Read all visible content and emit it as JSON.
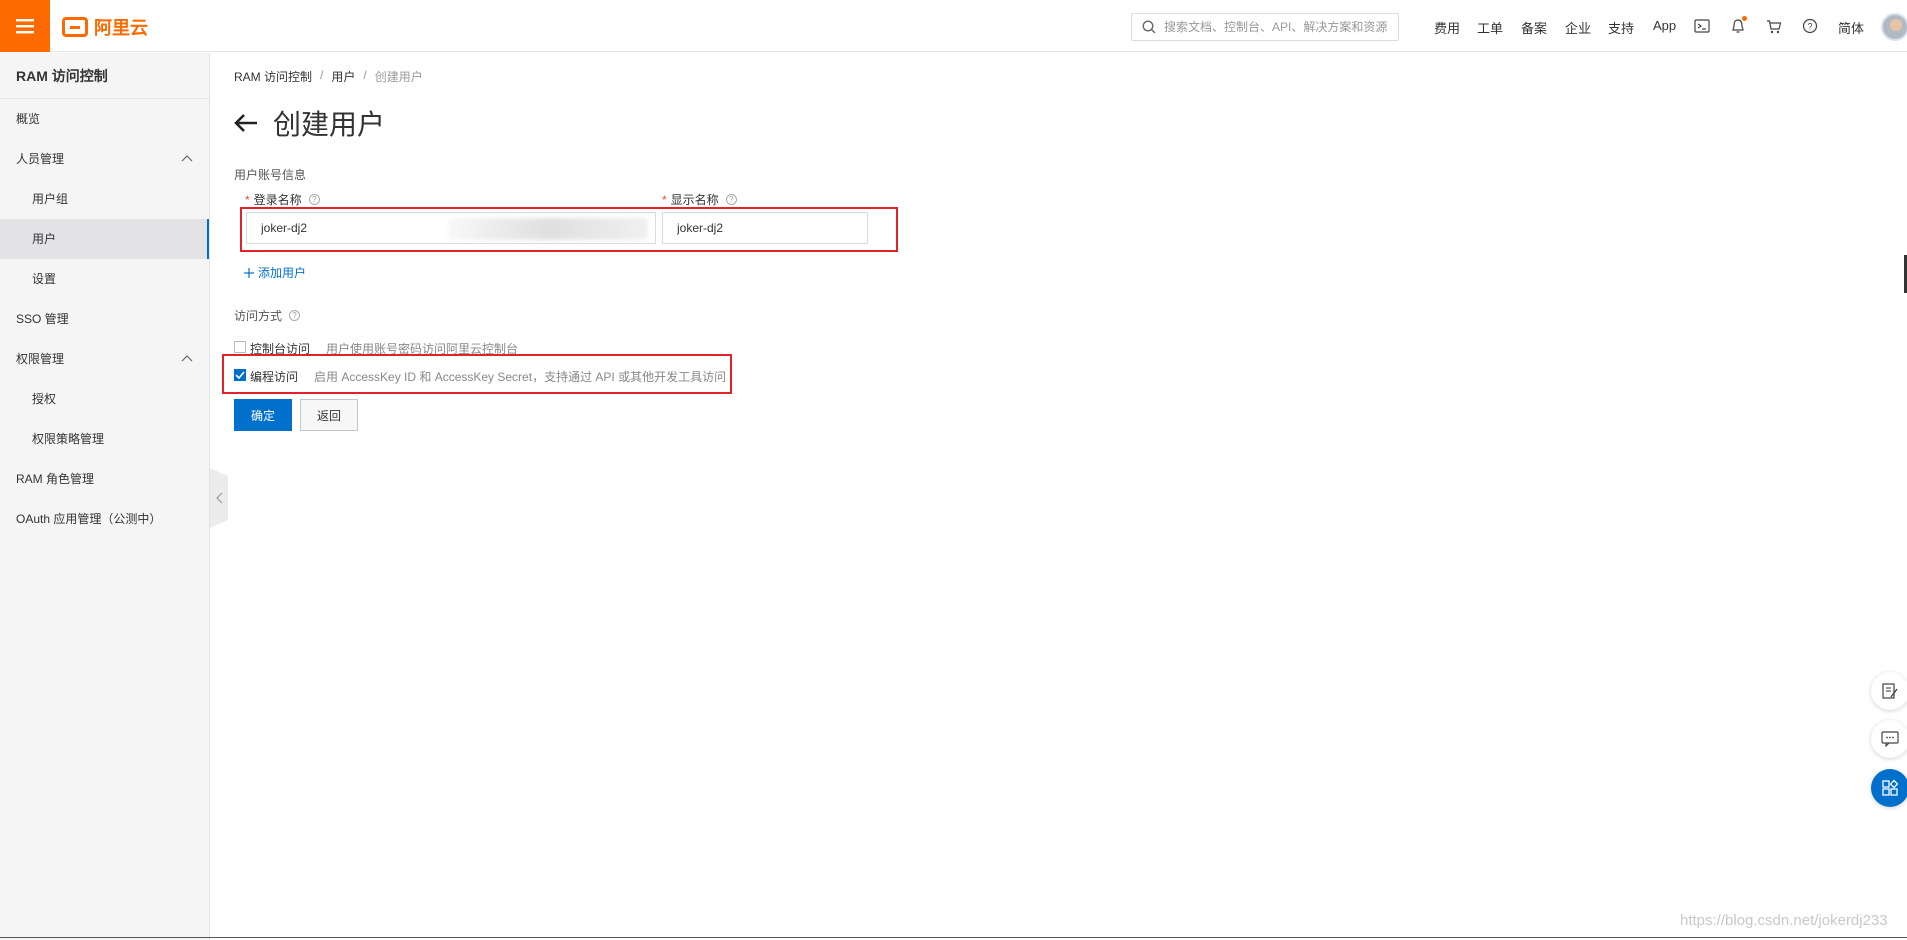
{
  "brand": {
    "name": "阿里云",
    "color": "#ff6a00"
  },
  "topbar": {
    "search_placeholder": "搜索文档、控制台、API、解决方案和资源",
    "nav_items": [
      "费用",
      "工单",
      "备案",
      "企业",
      "支持",
      "App"
    ],
    "lang": "简体",
    "icons": [
      "terminal-icon",
      "bell-icon",
      "cart-icon",
      "help-icon"
    ]
  },
  "sidebar": {
    "title": "RAM 访问控制",
    "items": [
      {
        "label": "概览"
      },
      {
        "label": "人员管理"
      },
      {
        "label": "用户组"
      },
      {
        "label": "用户"
      },
      {
        "label": "设置"
      },
      {
        "label": "SSO 管理"
      },
      {
        "label": "权限管理"
      },
      {
        "label": "授权"
      },
      {
        "label": "权限策略管理"
      },
      {
        "label": "RAM 角色管理"
      },
      {
        "label": "OAuth 应用管理（公测中）"
      }
    ],
    "active": "用户"
  },
  "breadcrumb": [
    "RAM 访问控制",
    "用户",
    "创建用户"
  ],
  "page": {
    "title": "创建用户",
    "account_section": "用户账号信息",
    "login_name_label": "登录名称",
    "login_name_value": "joker-dj2",
    "display_name_label": "显示名称",
    "display_name_value": "joker-dj2",
    "add_user": "添加用户",
    "access_section": "访问方式",
    "console_access": {
      "label": "控制台访问",
      "desc": "用户使用账号密码访问阿里云控制台",
      "checked": false
    },
    "programmatic_access": {
      "label": "编程访问",
      "desc": "启用 AccessKey ID 和 AccessKey Secret，支持通过 API 或其他开发工具访问",
      "checked": true
    },
    "confirm_button": "确定",
    "back_button": "返回"
  },
  "watermark": "https://blog.csdn.net/jokerdj233",
  "accent_color": "#0070cc"
}
